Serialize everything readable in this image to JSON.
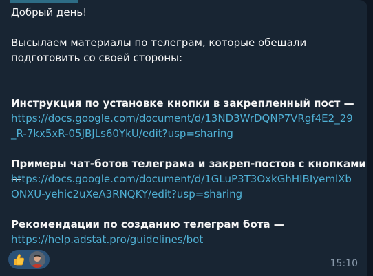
{
  "message": {
    "greeting": "Добрый день!",
    "intro_line1": "Высылаем материалы по телеграм, которые обещали",
    "intro_line2": "подготовить со своей стороны:",
    "items": [
      {
        "title": "Инструкция по установке кнопки в закрепленный пост —",
        "link_line1": "https://docs.google.com/document/d/13ND3WrDQNP7VRgf4E2_29",
        "link_line2": "_R-7kx5xR-05JBJLs60YkU/edit?usp=sharing"
      },
      {
        "title": "Примеры чат-ботов телеграма и закреп-постов с кнопками —",
        "link_line1": "https://docs.google.com/document/d/1GLuP3T3OxkGhHIBIyemlXb",
        "link_line2": "ONXU-yehic2uXeA3RNQKY/edit?usp=sharing"
      },
      {
        "title": "Рекомендации по созданию телеграм бота —",
        "link_line1": "https://help.adstat.pro/guidelines/bot"
      }
    ],
    "reaction": {
      "emoji_icon": "thumbs-up-icon",
      "emoji": "👍"
    },
    "timestamp": "15:10"
  },
  "colors": {
    "chat_background": "#0e1621",
    "bubble_background": "#182533",
    "text": "#f5f5f5",
    "link": "#4fb0d4",
    "timestamp": "#8a9aab",
    "reaction_pill": "#2b5278"
  }
}
